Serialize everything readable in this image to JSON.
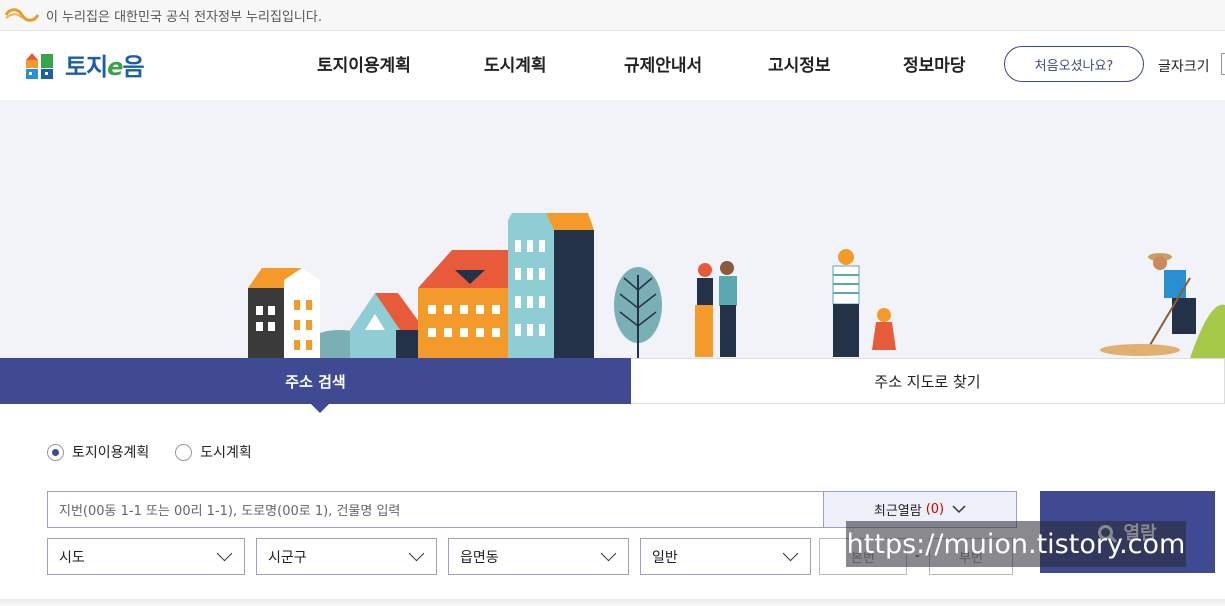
{
  "gov_banner": {
    "text": "이 누리집은 대한민국 공식 전자정부 누리집입니다."
  },
  "header": {
    "logo_text_a": "토지",
    "logo_text_e": "e",
    "logo_text_b": "음",
    "nav": [
      "토지이용계획",
      "도시계획",
      "규제안내서",
      "고시정보",
      "정보마당"
    ],
    "first_visit": "처음오셨나요?",
    "font_size_label": "글자크기"
  },
  "tabs": {
    "address_search": "주소 검색",
    "map_search": "주소 지도로 찾기"
  },
  "search": {
    "radio_options": [
      "토지이용계획",
      "도시계획"
    ],
    "selected_radio": 0,
    "placeholder": "지번(00동 1-1 또는 00리 1-1), 도로명(00로 1), 건물명 입력",
    "recent_label": "최근열람",
    "recent_count": "(0)",
    "view_button": "열람",
    "selects": [
      "시도",
      "시군구",
      "읍면동",
      "일반"
    ],
    "main_number": "본번",
    "sub_number": "부번",
    "separator": "-"
  },
  "watermark": "https://muion.tistory.com",
  "colors": {
    "primary": "#3f4a93",
    "accent_red": "#d30000",
    "hero_bg": "#f2f3f9"
  }
}
